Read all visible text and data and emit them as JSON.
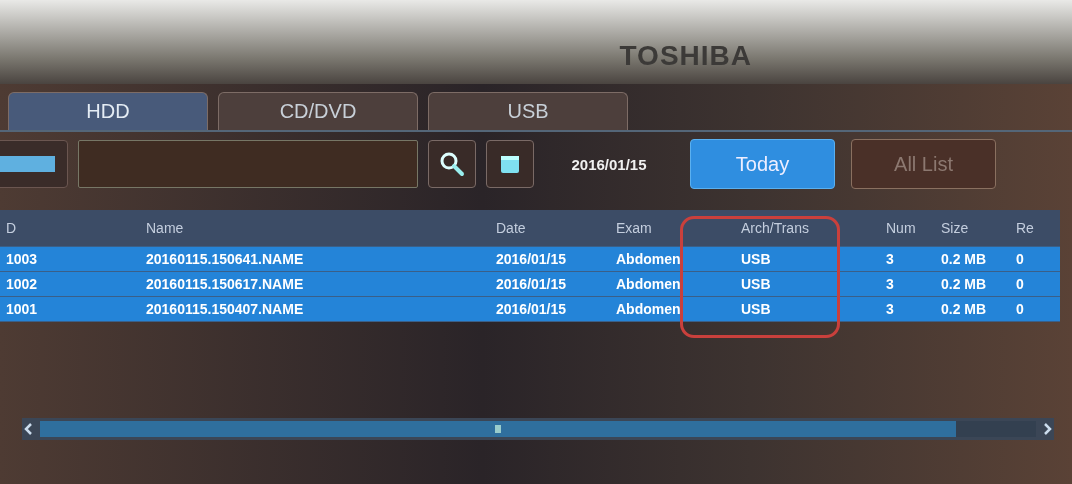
{
  "brand": "TOSHIBA",
  "tabs": [
    {
      "label": "HDD",
      "selected": true
    },
    {
      "label": "CD/DVD",
      "selected": false
    },
    {
      "label": "USB",
      "selected": false
    }
  ],
  "toolbar": {
    "date": "2016/01/15",
    "buttons": [
      {
        "label": "Today",
        "selected": true
      },
      {
        "label": "All List",
        "selected": false
      }
    ]
  },
  "table": {
    "columns": [
      "D",
      "Name",
      "Date",
      "Exam",
      "Arch/Trans",
      "Num",
      "Size",
      "Re"
    ],
    "rows": [
      {
        "cells": [
          "1003",
          "20160115.150641.NAME",
          "2016/01/15",
          "Abdomen",
          "USB",
          "3",
          "0.2 MB",
          "0"
        ],
        "selected": true
      },
      {
        "cells": [
          "1002",
          "20160115.150617.NAME",
          "2016/01/15",
          "Abdomen",
          "USB",
          "3",
          "0.2 MB",
          "0"
        ],
        "selected": true
      },
      {
        "cells": [
          "1001",
          "20160115.150407.NAME",
          "2016/01/15",
          "Abdomen",
          "USB",
          "3",
          "0.2 MB",
          "0"
        ],
        "selected": true
      }
    ]
  }
}
